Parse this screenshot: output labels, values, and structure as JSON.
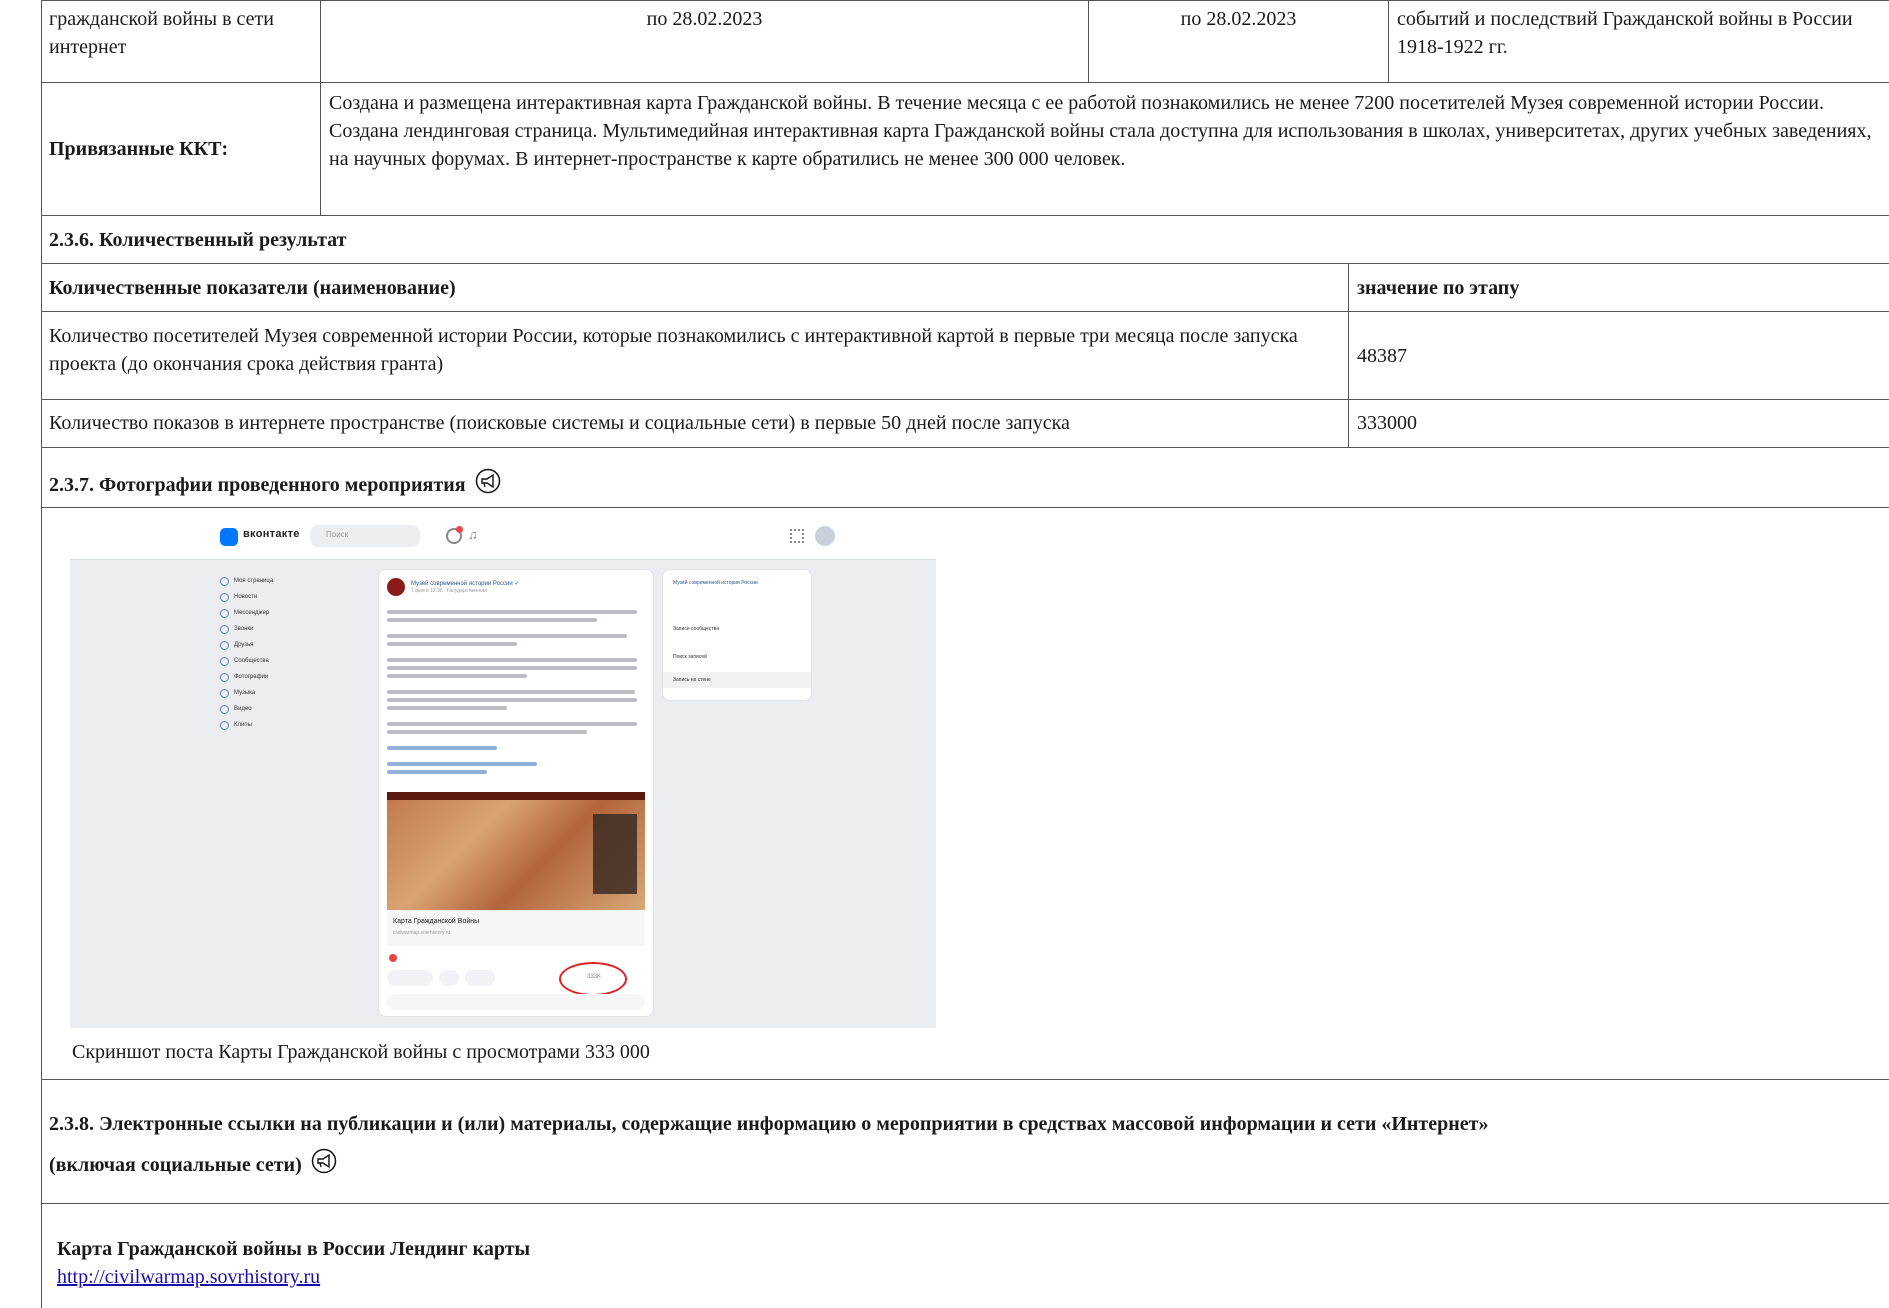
{
  "top_row": {
    "col1": "гражданской войны в сети интернет",
    "col2": "по 28.02.2023",
    "col3": "по 28.02.2023",
    "col4": "событий и последствий Гражданской войны в России 1918-1922 гг."
  },
  "kkt": {
    "label": "Привязанные ККТ:",
    "text": "Создана и размещена интерактивная карта Гражданской войны. В течение месяца с ее работой познакомились не менее 7200 посетителей Музея современной истории России. Создана лендинговая страница. Мультимедийная интерактивная карта Гражданской войны стала доступна для использования в школах, университетах, других учебных заведениях, на научных форумах. В интернет-пространстве к карте обратились не менее 300 000 человек."
  },
  "section_236": {
    "title": "2.3.6. Количественный результат"
  },
  "quant_table": {
    "header_name": "Количественные показатели (наименование)",
    "header_value": "значение по этапу",
    "rows": [
      {
        "name": "Количество посетителей Музея современной истории России, которые познакомились с интерактивной картой в первые три месяца после запуска проекта (до окончания срока действия гранта)",
        "value": "48387"
      },
      {
        "name": "Количество показов в интернете пространстве (поисковые системы и социальные сети) в первые 50 дней после запуска",
        "value": "333000"
      }
    ]
  },
  "section_237": {
    "title": "2.3.7. Фотографии проведенного мероприятия",
    "caption": "Скриншот поста Карты Гражданской войны с просмотрами 333 000"
  },
  "vk_screenshot": {
    "brand": "вконтакте",
    "search_placeholder": "Поиск",
    "nav": [
      "Моя страница",
      "Новости",
      "Мессенджер",
      "Звонки",
      "Друзья",
      "Сообщества",
      "Фотографии",
      "Музыка",
      "Видео",
      "Клипы"
    ],
    "post_author": "Музей современной истории России ✓",
    "post_time": "7 фев в 12:36 · Гасударственная",
    "map_caption_title": "Карта Гражданской Войны",
    "map_caption_url": "civilwarmap.sovrhistory.ru",
    "views": "333K",
    "side_items": [
      "Записи сообщества",
      "Поиск записей",
      "Запись на стене"
    ],
    "side_header": "Музей современной истории России"
  },
  "section_238": {
    "title_line1": "2.3.8. Электронные ссылки на публикации и (или) материалы, содержащие информацию о мероприятии в средствах массовой информации и сети «Интернет»",
    "title_line2": "(включая социальные сети)",
    "link_title": "Карта Гражданской войны в России Лендинг карты",
    "link_url": "http://civilwarmap.sovrhistory.ru"
  }
}
